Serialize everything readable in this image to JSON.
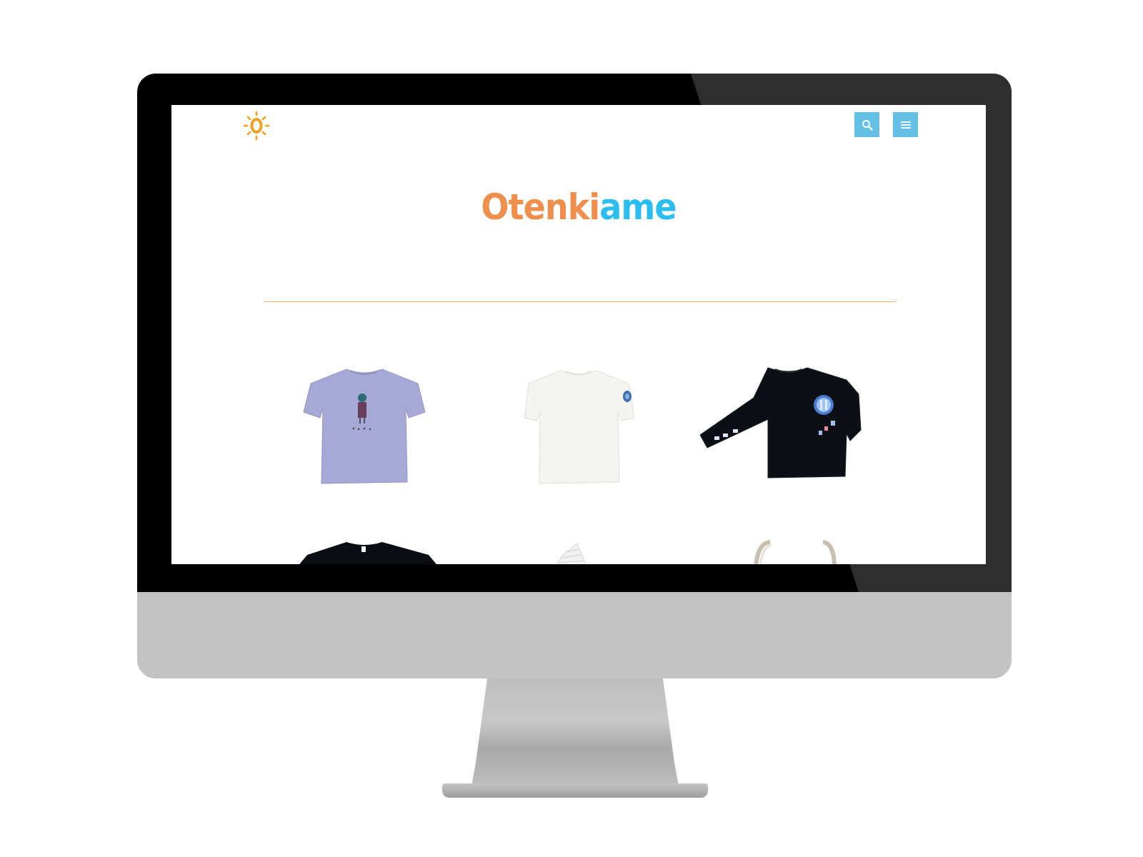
{
  "site": {
    "brand_part1": "Otenki",
    "brand_part2": "ame"
  },
  "header": {
    "logo_icon": "sun-o-logo",
    "search_icon": "search-icon",
    "menu_icon": "hamburger-menu-icon"
  },
  "colors": {
    "accent_orange": "#f08e4b",
    "accent_blue": "#29bdf0",
    "button_blue": "#64c0e5",
    "divider_orange": "#f6ad6e"
  },
  "products": [
    {
      "name": "gray-tshirt-character-print"
    },
    {
      "name": "white-tshirt-sleeve-patch"
    },
    {
      "name": "black-longsleeve-tshirt-print"
    },
    {
      "name": "black-tshirt"
    },
    {
      "name": "striped-item"
    },
    {
      "name": "tote-bag"
    }
  ]
}
